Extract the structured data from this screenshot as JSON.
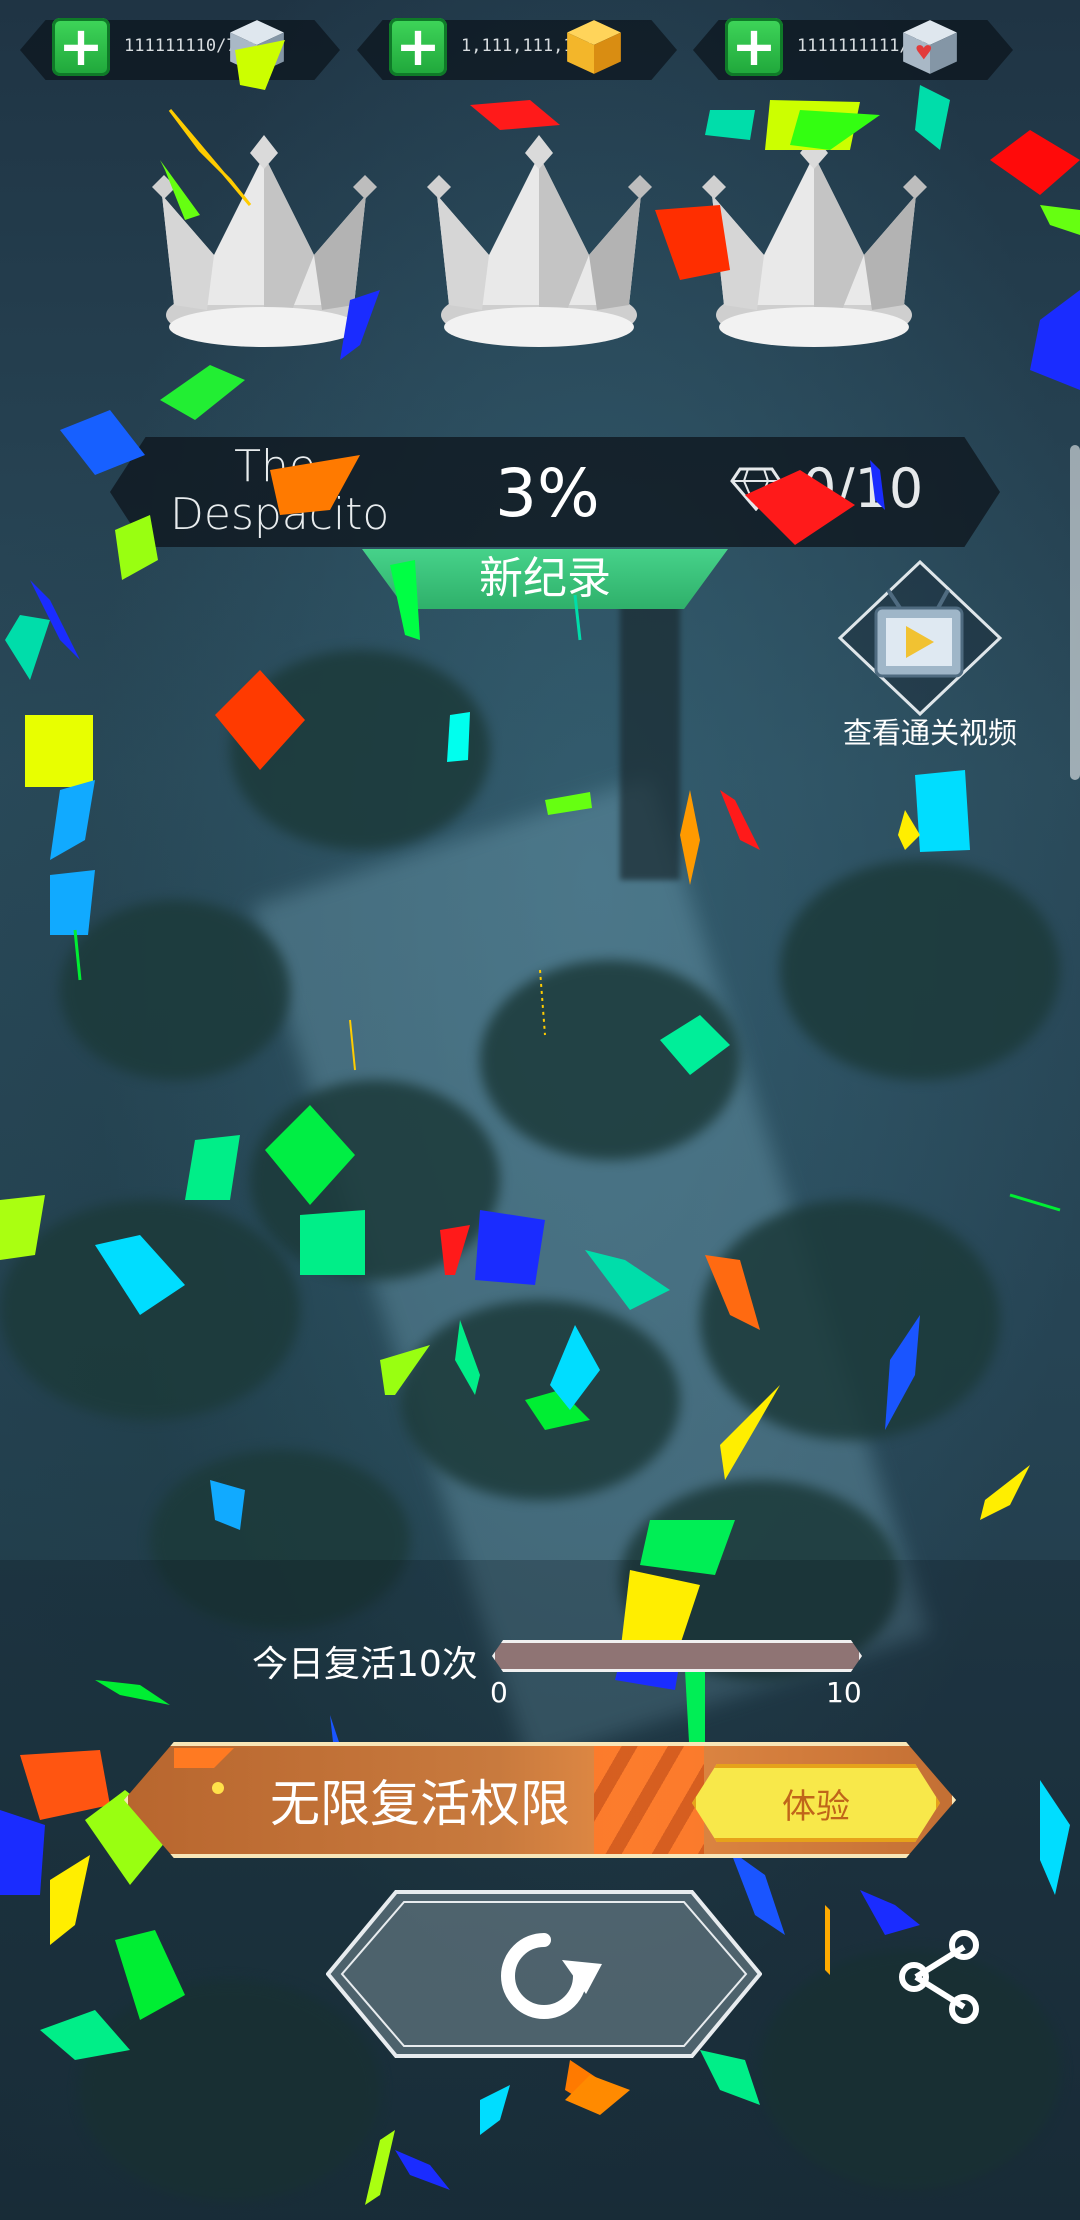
{
  "resources": [
    {
      "value": "111111110/715",
      "icon": "silver-cube-icon",
      "icon_color": "#a9b8c6"
    },
    {
      "value": "1,111,111,111",
      "icon": "gold-cube-icon",
      "icon_color": "#f3b62a"
    },
    {
      "value": "1111111111/40",
      "icon": "heart-cube-icon",
      "icon_color": "#e23b3b"
    }
  ],
  "crowns": [
    "crown-icon",
    "crown-icon",
    "crown-icon"
  ],
  "level": {
    "title": "The Despacito",
    "progress": "3%",
    "progress_value": 0.03,
    "gems": "0/10",
    "gem_icon": "diamond-icon"
  },
  "record_label": "新纪录",
  "video_button": {
    "label": "查看通关视频",
    "icon": "video-tv-icon"
  },
  "revive": {
    "label": "今日复活10次",
    "min": "0",
    "max": "10"
  },
  "unlimited_banner": {
    "label": "无限复活权限",
    "button_label": "体验"
  },
  "replay_icon": "replay-icon",
  "share_icon": "share-icon",
  "colors": {
    "record_green": "#3cc27a",
    "banner_orange": "#c8783c",
    "try_yellow": "#f8e84a",
    "plus_green": "#2fc04a"
  }
}
